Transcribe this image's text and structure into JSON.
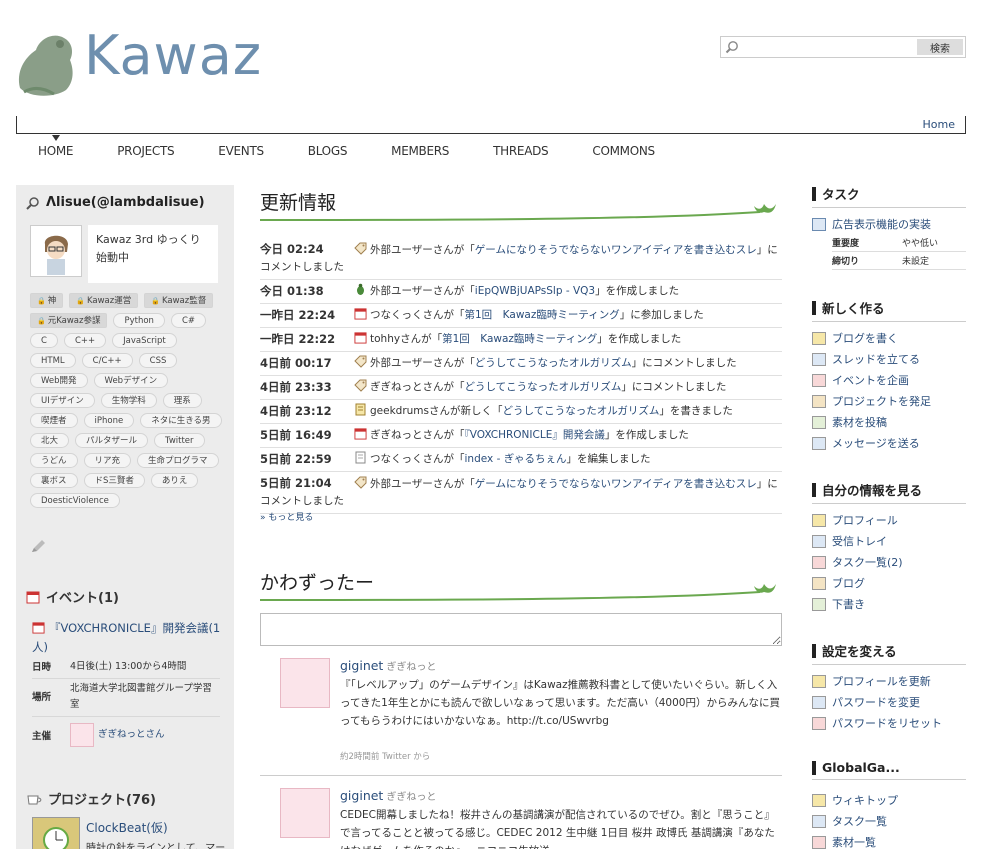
{
  "header": {
    "logo_text": "Kawaz",
    "search": {
      "placeholder": "",
      "button": "検索"
    },
    "breadcrumb_home": "Home",
    "nav": [
      "HOME",
      "PROJECTS",
      "EVENTS",
      "BLOGS",
      "MEMBERS",
      "THREADS",
      "COMMONS"
    ]
  },
  "user": {
    "name": "Λlisue(@lambdalisue)",
    "description": "Kawaz 3rd ゆっくり始動中",
    "tags": [
      {
        "label": "神",
        "locked": true
      },
      {
        "label": "Kawaz運営",
        "locked": true
      },
      {
        "label": "Kawaz監督",
        "locked": true
      },
      {
        "label": "元Kawaz参謀",
        "locked": true
      },
      {
        "label": "Python"
      },
      {
        "label": "C#"
      },
      {
        "label": "C"
      },
      {
        "label": "C++"
      },
      {
        "label": "JavaScript"
      },
      {
        "label": "HTML"
      },
      {
        "label": "C/C++"
      },
      {
        "label": "CSS"
      },
      {
        "label": "Web開発"
      },
      {
        "label": "Webデザイン"
      },
      {
        "label": "UIデザイン"
      },
      {
        "label": "生物学科"
      },
      {
        "label": "理系"
      },
      {
        "label": "喫煙者"
      },
      {
        "label": "iPhone"
      },
      {
        "label": "ネタに生きる男"
      },
      {
        "label": "北大"
      },
      {
        "label": "パルタザール"
      },
      {
        "label": "Twitter"
      },
      {
        "label": "うどん"
      },
      {
        "label": "リア充"
      },
      {
        "label": "生命プログラマ"
      },
      {
        "label": "裏ボス"
      },
      {
        "label": "ドS三賢者"
      },
      {
        "label": "ありえ"
      },
      {
        "label": "DoesticViolence"
      }
    ]
  },
  "event": {
    "heading": "イベント(1)",
    "title": "『VOXCHRONICLE』開発会議(1人)",
    "rows": [
      {
        "key": "日時",
        "value": "4日後(土) 13:00から4時間"
      },
      {
        "key": "場所",
        "value": "北海道大学北図書館グループ学習室"
      },
      {
        "key": "主催",
        "value": "ぎぎねっとさん"
      }
    ]
  },
  "project": {
    "heading": "プロジェクト(76)",
    "name": "ClockBeat(仮)",
    "description": "時計の針をラインとして、マー"
  },
  "updates": {
    "title": "更新情報",
    "items": [
      {
        "time": "今日 02:24",
        "pre": "外部ユーザーさんが「",
        "link": "ゲームになりそうでならないワンアイディアを書き込むスレ",
        "post": "」にコメントしました",
        "icon": "tag"
      },
      {
        "time": "今日 01:38",
        "pre": "外部ユーザーさんが「",
        "link": "iEpQWBjUAPsSlp - VQ3",
        "post": "」を作成しました",
        "icon": "bug"
      },
      {
        "time": "一昨日 22:24",
        "pre": "つなくっくさんが「",
        "link": "第1回　Kawaz臨時ミーティング",
        "post": "」に参加しました",
        "icon": "calendar"
      },
      {
        "time": "一昨日 22:22",
        "pre": "tohhyさんが「",
        "link": "第1回　Kawaz臨時ミーティング",
        "post": "」を作成しました",
        "icon": "calendar"
      },
      {
        "time": "4日前 00:17",
        "pre": "外部ユーザーさんが「",
        "link": "どうしてこうなったオルガリズム",
        "post": "」にコメントしました",
        "icon": "tag"
      },
      {
        "time": "4日前 23:33",
        "pre": "ぎぎねっとさんが「",
        "link": "どうしてこうなったオルガリズム",
        "post": "」にコメントしました",
        "icon": "tag"
      },
      {
        "time": "4日前 23:12",
        "pre": "geekdrumsさんが新しく「",
        "link": "どうしてこうなったオルガリズム",
        "post": "」を書きました",
        "icon": "note"
      },
      {
        "time": "5日前 16:49",
        "pre": "ぎぎねっとさんが「",
        "link": "『VOXCHRONICLE』開発会議",
        "post": "」を作成しました",
        "icon": "calendar"
      },
      {
        "time": "5日前 22:59",
        "pre": "つなくっくさんが「",
        "link": "index - ぎゃるちぇん",
        "post": "」を編集しました",
        "icon": "doc"
      },
      {
        "time": "5日前 21:04",
        "pre": "外部ユーザーさんが「",
        "link": "ゲームになりそうでならないワンアイディアを書き込むスレ",
        "post": "」にコメントしました",
        "icon": "tag"
      }
    ],
    "more": "もっと見る"
  },
  "kawazutter": {
    "title": "かわずったー",
    "tweets": [
      {
        "user": "giginet",
        "sub": "ぎぎねっと",
        "body": "『「レベルアップ」のゲームデザイン』はKawaz推薦教科書として使いたいぐらい。新しく入ってきた1年生とかにも読んで欲しいなぁって思います。ただ高い（4000円）からみんなに買ってもらうわけにはいかないなぁ。http://t.co/USwvrbg",
        "meta": "約2時間前 Twitter から"
      },
      {
        "user": "giginet",
        "sub": "ぎぎねっと",
        "body": "CEDEC開幕しましたね！桜井さんの基調講演が配信されているのでぜひ。割と『思うこと』で言ってることと被ってる感じ。CEDEC 2012 生中継 1日目 桜井 政博氏 基調講演『あなたはなぜゲームを作るのか』 - ニコニコ生放送",
        "meta": ""
      }
    ]
  },
  "right": {
    "task": {
      "heading": "タスク",
      "link": "広告表示機能の実装",
      "rows": [
        {
          "key": "重要度",
          "value": "やや低い"
        },
        {
          "key": "締切り",
          "value": "未設定"
        }
      ]
    },
    "create": {
      "heading": "新しく作る",
      "items": [
        "ブログを書く",
        "スレッドを立てる",
        "イベントを企画",
        "プロジェクトを発足",
        "素材を投稿",
        "メッセージを送る"
      ]
    },
    "myinfo": {
      "heading": "自分の情報を見る",
      "items": [
        "プロフィール",
        "受信トレイ",
        "タスク一覧(2)",
        "ブログ",
        "下書き"
      ]
    },
    "settings": {
      "heading": "設定を変える",
      "items": [
        "プロフィールを更新",
        "パスワードを変更",
        "パスワードをリセット"
      ]
    },
    "global": {
      "heading": "GlobalGa...",
      "items": [
        "ウィキトップ",
        "タスク一覧",
        "素材一覧"
      ]
    }
  },
  "colors": {
    "link": "#2a4d7a",
    "accent_green": "#6aa84f",
    "sidebar_bg": "#ececec"
  }
}
